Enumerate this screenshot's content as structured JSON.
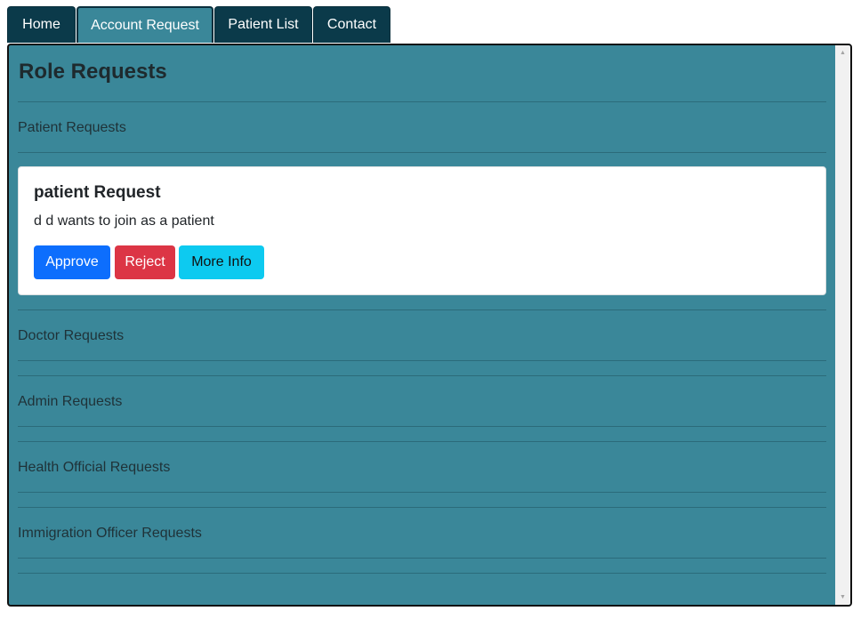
{
  "nav": {
    "tabs": [
      {
        "label": "Home"
      },
      {
        "label": "Account Request"
      },
      {
        "label": "Patient List"
      },
      {
        "label": "Contact"
      }
    ],
    "active_tab": "Account Request"
  },
  "page": {
    "title": "Role Requests"
  },
  "sections": {
    "patient": {
      "label": "Patient Requests"
    },
    "doctor": {
      "label": "Doctor Requests"
    },
    "admin": {
      "label": "Admin Requests"
    },
    "health_official": {
      "label": "Health Official Requests"
    },
    "immigration_officer": {
      "label": "Immigration Officer Requests"
    }
  },
  "request_card": {
    "title": "patient Request",
    "message": "d d wants to join as a patient",
    "approve_label": "Approve",
    "reject_label": "Reject",
    "more_info_label": "More Info"
  },
  "scrollbar": {
    "up_icon": "triangle-up-icon",
    "down_icon": "triangle-down-icon"
  },
  "colors": {
    "nav_bg": "#0b3a4a",
    "active_tab_bg": "#3a8799",
    "panel_bg": "#3a8799",
    "approve": "#0d6efd",
    "reject": "#dc3545",
    "more_info": "#0dcaf0"
  }
}
